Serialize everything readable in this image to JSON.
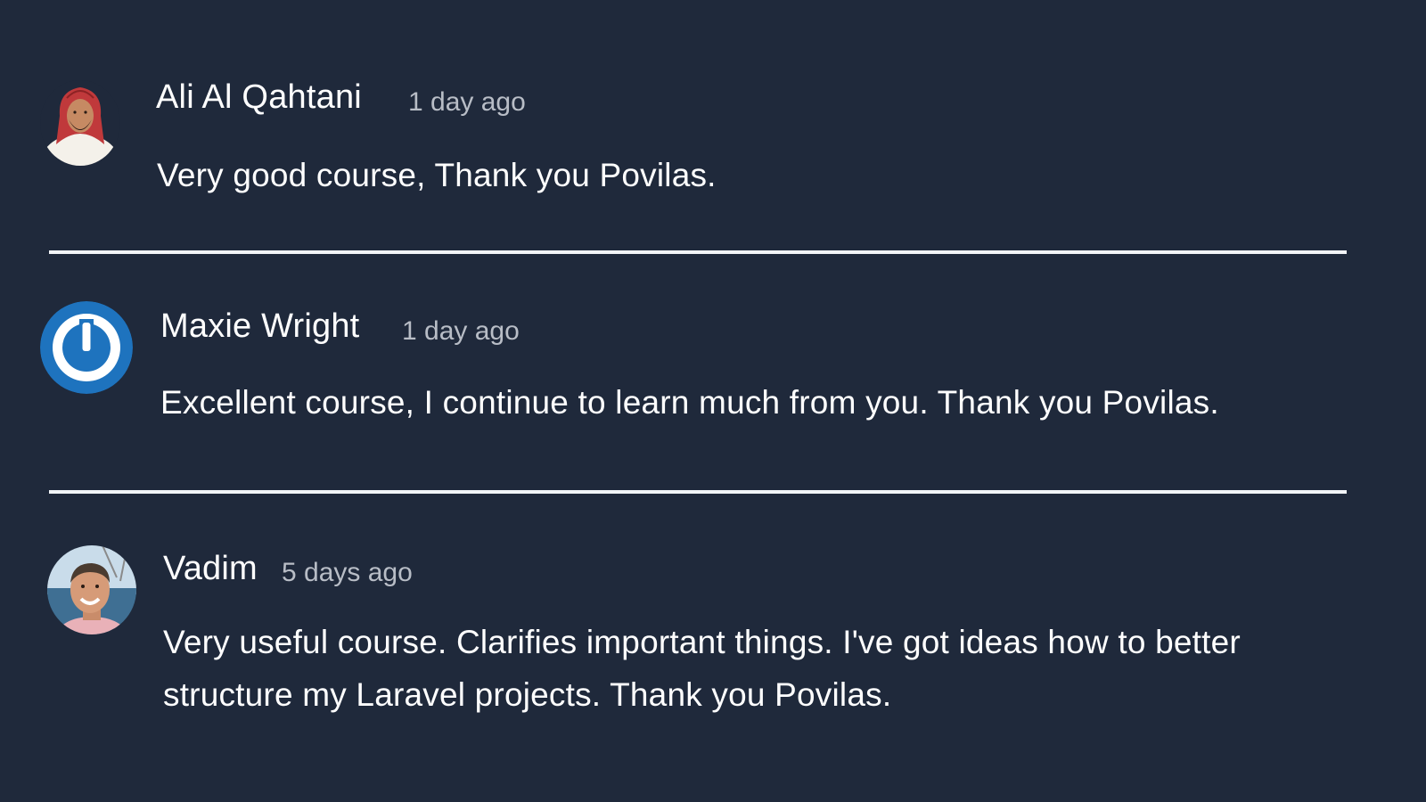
{
  "reviews": [
    {
      "author": "Ali Al Qahtani",
      "time": "1 day ago",
      "text": "Very good course, Thank you Povilas.",
      "avatar_icon": "person-photo-icon"
    },
    {
      "author": "Maxie Wright",
      "time": "1 day ago",
      "text": "Excellent course, I continue to learn much from you. Thank you Povilas.",
      "avatar_icon": "power-icon"
    },
    {
      "author": "Vadim",
      "time": "5 days ago",
      "text": "Very useful course. Clarifies important things. I've got ideas how to better structure my Laravel projects. Thank you Povilas.",
      "avatar_icon": "person-photo-icon"
    }
  ],
  "colors": {
    "background": "#1f293b",
    "text": "#ffffff",
    "time": "#b8bdc6",
    "divider": "#f2f4f7",
    "power_avatar": "#1e73be"
  }
}
